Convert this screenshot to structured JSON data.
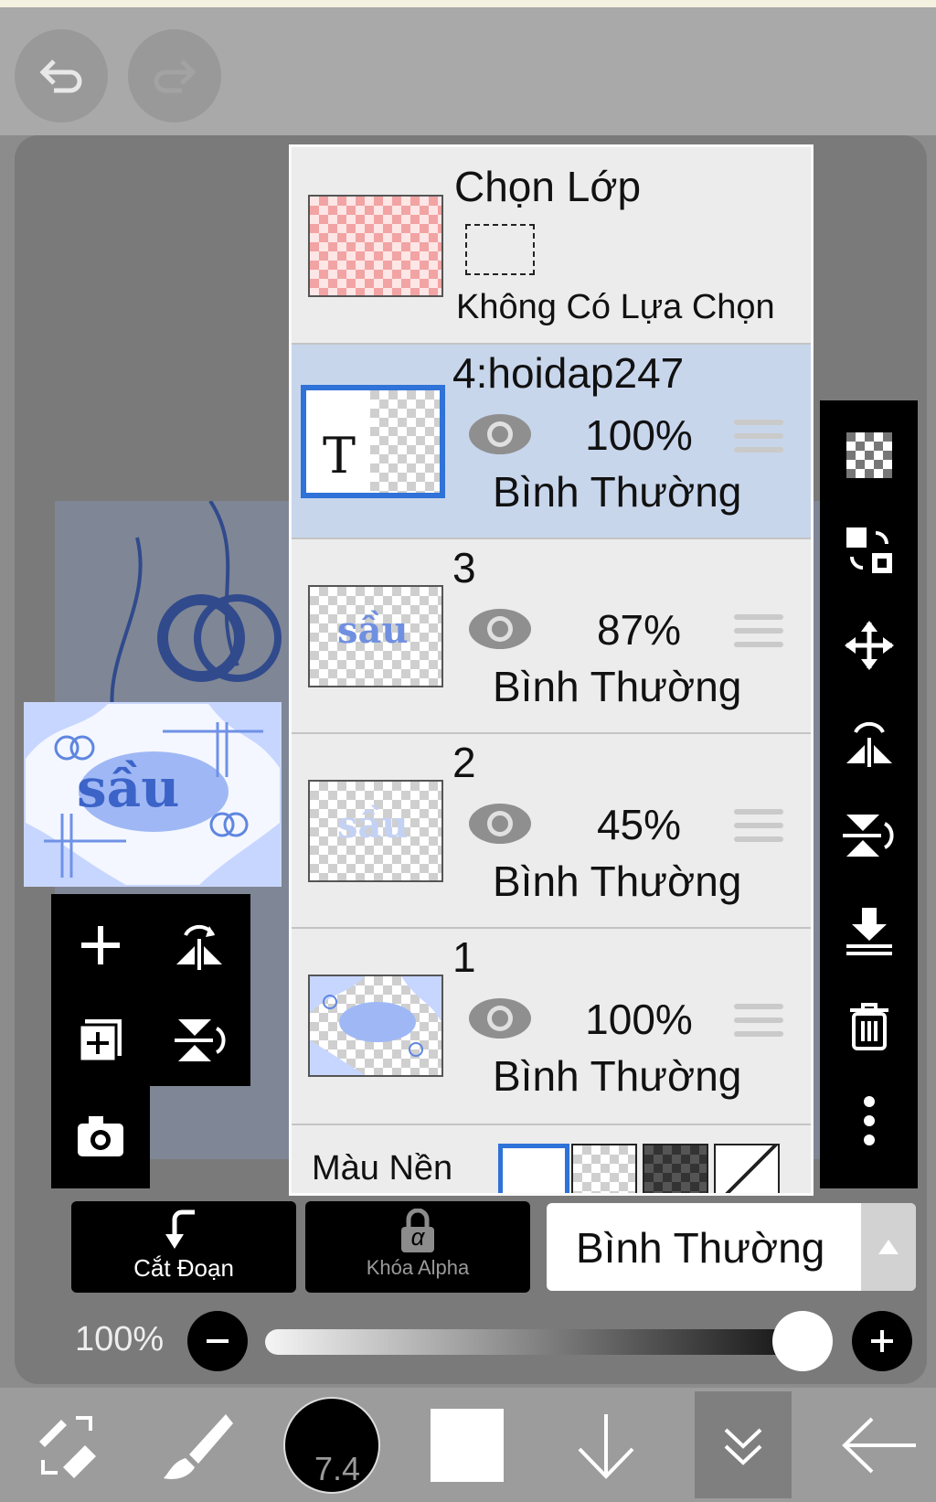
{
  "topbar": {
    "undo_icon": "undo-icon",
    "redo_icon": "redo-icon"
  },
  "layer_panel": {
    "selection": {
      "title": "Chọn Lớp",
      "status": "Không Có Lựa Chọn"
    },
    "layers": [
      {
        "name": "4:hoidap247",
        "opacity": "100%",
        "blend": "Bình Thường",
        "active": true,
        "thumb_text": "T"
      },
      {
        "name": "3",
        "opacity": "87%",
        "blend": "Bình Thường",
        "thumb_text": "sầu"
      },
      {
        "name": "2",
        "opacity": "45%",
        "blend": "Bình Thường",
        "thumb_text": "sầu"
      },
      {
        "name": "1",
        "opacity": "100%",
        "blend": "Bình Thường"
      }
    ],
    "background_label": "Màu Nền"
  },
  "preview": {
    "text": "sầu"
  },
  "bottom_controls": {
    "cut_label": "Cắt Đoạn",
    "alpha_label": "Khóa Alpha",
    "alpha_symbol": "α",
    "blend_mode": "Bình Thường",
    "opacity_label": "100%",
    "opacity_value": 1.0
  },
  "bottom_bar": {
    "brush_size": "7.4"
  },
  "colors": {
    "active_layer": "#c8d6ec",
    "selection_blue": "#2f72d8",
    "toolbar_bg": "#000000"
  }
}
